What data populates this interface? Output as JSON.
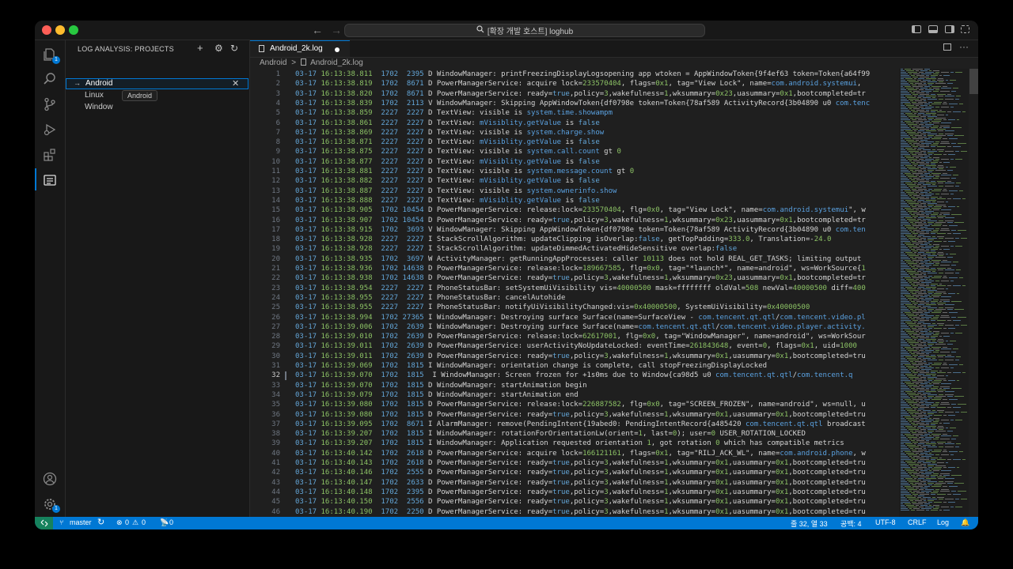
{
  "titlebar": {
    "search_text": "[확장 개발 호스트] loghub"
  },
  "activity": {
    "explorer_badge": "1",
    "accounts_label": "",
    "settings_badge": "1"
  },
  "sidebar": {
    "title": "LOG ANALYSIS: PROJECTS",
    "items": [
      {
        "label": "Android"
      },
      {
        "label": "Linux"
      },
      {
        "label": "Window"
      }
    ],
    "tooltip": "Android"
  },
  "editor": {
    "tab_label": "Android_2k.log",
    "breadcrumb": [
      "Android",
      ">",
      "Android_2k.log"
    ],
    "lines": [
      {
        "n": "1",
        "date": "03-17",
        "time": "16:13:38.811",
        "pid": "1702",
        "tid": "2395",
        "lvl": "D",
        "msg": "WindowManager: printFreezingDisplayLogsopening app wtoken = AppWindowToken{9f4ef63 token=Token{a64f99"
      },
      {
        "n": "2",
        "date": "03-17",
        "time": "16:13:38.819",
        "pid": "1702",
        "tid": "8671",
        "lvl": "D",
        "msg": "PowerManagerService: acquire lock=233570404, flags=0x1, tag=\"View Lock\", name=com.android.systemui,"
      },
      {
        "n": "3",
        "date": "03-17",
        "time": "16:13:38.820",
        "pid": "1702",
        "tid": "8671",
        "lvl": "D",
        "msg": "PowerManagerService: ready=true,policy=3,wakefulness=1,wksummary=0x23,uasummary=0x1,bootcompleted=tr"
      },
      {
        "n": "4",
        "date": "03-17",
        "time": "16:13:38.839",
        "pid": "1702",
        "tid": "2113",
        "lvl": "V",
        "msg": "WindowManager: Skipping AppWindowToken{df0798e token=Token{78af589 ActivityRecord{3b04890 u0 com.tenc"
      },
      {
        "n": "5",
        "date": "03-17",
        "time": "16:13:38.859",
        "pid": "2227",
        "tid": "2227",
        "lvl": "D",
        "msg": "TextView: visible is system.time.showampm"
      },
      {
        "n": "6",
        "date": "03-17",
        "time": "16:13:38.861",
        "pid": "2227",
        "tid": "2227",
        "lvl": "D",
        "msg": "TextView: mVisiblity.getValue is false"
      },
      {
        "n": "7",
        "date": "03-17",
        "time": "16:13:38.869",
        "pid": "2227",
        "tid": "2227",
        "lvl": "D",
        "msg": "TextView: visible is system.charge.show"
      },
      {
        "n": "8",
        "date": "03-17",
        "time": "16:13:38.871",
        "pid": "2227",
        "tid": "2227",
        "lvl": "D",
        "msg": "TextView: mVisiblity.getValue is false"
      },
      {
        "n": "9",
        "date": "03-17",
        "time": "16:13:38.875",
        "pid": "2227",
        "tid": "2227",
        "lvl": "D",
        "msg": "TextView: visible is system.call.count gt 0"
      },
      {
        "n": "10",
        "date": "03-17",
        "time": "16:13:38.877",
        "pid": "2227",
        "tid": "2227",
        "lvl": "D",
        "msg": "TextView: mVisiblity.getValue is false"
      },
      {
        "n": "11",
        "date": "03-17",
        "time": "16:13:38.881",
        "pid": "2227",
        "tid": "2227",
        "lvl": "D",
        "msg": "TextView: visible is system.message.count gt 0"
      },
      {
        "n": "12",
        "date": "03-17",
        "time": "16:13:38.882",
        "pid": "2227",
        "tid": "2227",
        "lvl": "D",
        "msg": "TextView: mVisiblity.getValue is false"
      },
      {
        "n": "13",
        "date": "03-17",
        "time": "16:13:38.887",
        "pid": "2227",
        "tid": "2227",
        "lvl": "D",
        "msg": "TextView: visible is system.ownerinfo.show"
      },
      {
        "n": "14",
        "date": "03-17",
        "time": "16:13:38.888",
        "pid": "2227",
        "tid": "2227",
        "lvl": "D",
        "msg": "TextView: mVisiblity.getValue is false"
      },
      {
        "n": "15",
        "date": "03-17",
        "time": "16:13:38.905",
        "pid": "1702",
        "tid": "10454",
        "lvl": "D",
        "msg": "PowerManagerService: release:lock=233570404, flg=0x0, tag=\"View Lock\", name=com.android.systemui\", w"
      },
      {
        "n": "16",
        "date": "03-17",
        "time": "16:13:38.907",
        "pid": "1702",
        "tid": "10454",
        "lvl": "D",
        "msg": "PowerManagerService: ready=true,policy=3,wakefulness=1,wksummary=0x23,uasummary=0x1,bootcompleted=tr"
      },
      {
        "n": "17",
        "date": "03-17",
        "time": "16:13:38.915",
        "pid": "1702",
        "tid": "3693",
        "lvl": "V",
        "msg": "WindowManager: Skipping AppWindowToken{df0798e token=Token{78af589 ActivityRecord{3b04890 u0 com.ten"
      },
      {
        "n": "18",
        "date": "03-17",
        "time": "16:13:38.928",
        "pid": "2227",
        "tid": "2227",
        "lvl": "I",
        "msg": "StackScrollAlgorithm: updateClipping isOverlap:false, getTopPadding=333.0, Translation=-24.0"
      },
      {
        "n": "19",
        "date": "03-17",
        "time": "16:13:38.928",
        "pid": "2227",
        "tid": "2227",
        "lvl": "I",
        "msg": "StackScrollAlgorithm: updateDimmedActivatedHideSensitive overlap:false"
      },
      {
        "n": "20",
        "date": "03-17",
        "time": "16:13:38.935",
        "pid": "1702",
        "tid": "3697",
        "lvl": "W",
        "msg": "ActivityManager: getRunningAppProcesses: caller 10113 does not hold REAL_GET_TASKS; limiting output"
      },
      {
        "n": "21",
        "date": "03-17",
        "time": "16:13:38.936",
        "pid": "1702",
        "tid": "14638",
        "lvl": "D",
        "msg": "PowerManagerService: release:lock=189667585, flg=0x0, tag=\"*launch*\", name=android\", ws=WorkSource{1"
      },
      {
        "n": "22",
        "date": "03-17",
        "time": "16:13:38.938",
        "pid": "1702",
        "tid": "14638",
        "lvl": "D",
        "msg": "PowerManagerService: ready=true,policy=3,wakefulness=1,wksummary=0x23,uasummary=0x1,bootcompleted=tr"
      },
      {
        "n": "23",
        "date": "03-17",
        "time": "16:13:38.954",
        "pid": "2227",
        "tid": "2227",
        "lvl": "I",
        "msg": "PhoneStatusBar: setSystemUiVisibility vis=40000500 mask=ffffffff oldVal=508 newVal=40000500 diff=400"
      },
      {
        "n": "24",
        "date": "03-17",
        "time": "16:13:38.955",
        "pid": "2227",
        "tid": "2227",
        "lvl": "I",
        "msg": "PhoneStatusBar: cancelAutohide"
      },
      {
        "n": "25",
        "date": "03-17",
        "time": "16:13:38.955",
        "pid": "2227",
        "tid": "2227",
        "lvl": "I",
        "msg": "PhoneStatusBar: notifyUiVisibilityChanged:vis=0x40000500, SystemUiVisibility=0x40000500"
      },
      {
        "n": "26",
        "date": "03-17",
        "time": "16:13:38.994",
        "pid": "1702",
        "tid": "27365",
        "lvl": "I",
        "msg": "WindowManager: Destroying surface Surface(name=SurfaceView - com.tencent.qt.qtl/com.tencent.video.pl"
      },
      {
        "n": "27",
        "date": "03-17",
        "time": "16:13:39.006",
        "pid": "1702",
        "tid": "2639",
        "lvl": "I",
        "msg": "WindowManager: Destroying surface Surface(name=com.tencent.qt.qtl/com.tencent.video.player.activity."
      },
      {
        "n": "28",
        "date": "03-17",
        "time": "16:13:39.010",
        "pid": "1702",
        "tid": "2639",
        "lvl": "D",
        "msg": "PowerManagerService: release:lock=62617001, flg=0x0, tag=\"WindowManager\", name=android\", ws=WorkSour"
      },
      {
        "n": "29",
        "date": "03-17",
        "time": "16:13:39.011",
        "pid": "1702",
        "tid": "2639",
        "lvl": "D",
        "msg": "PowerManagerService: userActivityNoUpdateLocked: eventTime=261843648, event=0, flags=0x1, uid=1000"
      },
      {
        "n": "30",
        "date": "03-17",
        "time": "16:13:39.011",
        "pid": "1702",
        "tid": "2639",
        "lvl": "D",
        "msg": "PowerManagerService: ready=true,policy=3,wakefulness=1,wksummary=0x1,uasummary=0x1,bootcompleted=tru"
      },
      {
        "n": "31",
        "date": "03-17",
        "time": "16:13:39.069",
        "pid": "1702",
        "tid": "1815",
        "lvl": "I",
        "msg": "WindowManager: orientation change is complete, call stopFreezingDisplayLocked"
      },
      {
        "n": "32",
        "date": "03-17",
        "time": "16:13:39.070",
        "pid": "1702",
        "tid": "1815",
        "lvl": " I",
        "msg": "WindowManager: Screen frozen for +1s0ms due to Window{ca98d5 u0 com.tencent.qt.qtl/com.tencent.q"
      },
      {
        "n": "33",
        "date": "03-17",
        "time": "16:13:39.070",
        "pid": "1702",
        "tid": "1815",
        "lvl": "D",
        "msg": "WindowManager: startAnimation begin"
      },
      {
        "n": "34",
        "date": "03-17",
        "time": "16:13:39.079",
        "pid": "1702",
        "tid": "1815",
        "lvl": "D",
        "msg": "WindowManager: startAnimation end"
      },
      {
        "n": "35",
        "date": "03-17",
        "time": "16:13:39.080",
        "pid": "1702",
        "tid": "1815",
        "lvl": "D",
        "msg": "PowerManagerService: release:lock=226887582, flg=0x0, tag=\"SCREEN_FROZEN\", name=android\", ws=null, u"
      },
      {
        "n": "36",
        "date": "03-17",
        "time": "16:13:39.080",
        "pid": "1702",
        "tid": "1815",
        "lvl": "D",
        "msg": "PowerManagerService: ready=true,policy=3,wakefulness=1,wksummary=0x1,uasummary=0x1,bootcompleted=tru"
      },
      {
        "n": "37",
        "date": "03-17",
        "time": "16:13:39.095",
        "pid": "1702",
        "tid": "8671",
        "lvl": "I",
        "msg": "AlarmManager: remove(PendingIntent{19abed0: PendingIntentRecord{a485420 com.tencent.qt.qtl broadcast"
      },
      {
        "n": "38",
        "date": "03-17",
        "time": "16:13:39.207",
        "pid": "1702",
        "tid": "1815",
        "lvl": "I",
        "msg": "WindowManager: rotationForOrientationLw(orient=1, last=0); user=0 USER_ROTATION_LOCKED"
      },
      {
        "n": "39",
        "date": "03-17",
        "time": "16:13:39.207",
        "pid": "1702",
        "tid": "1815",
        "lvl": "I",
        "msg": "WindowManager: Application requested orientation 1, got rotation 0 which has compatible metrics"
      },
      {
        "n": "40",
        "date": "03-17",
        "time": "16:13:40.142",
        "pid": "1702",
        "tid": "2618",
        "lvl": "D",
        "msg": "PowerManagerService: acquire lock=166121161, flags=0x1, tag=\"RILJ_ACK_WL\", name=com.android.phone, w"
      },
      {
        "n": "41",
        "date": "03-17",
        "time": "16:13:40.143",
        "pid": "1702",
        "tid": "2618",
        "lvl": "D",
        "msg": "PowerManagerService: ready=true,policy=3,wakefulness=1,wksummary=0x1,uasummary=0x1,bootcompleted=tru"
      },
      {
        "n": "42",
        "date": "03-17",
        "time": "16:13:40.146",
        "pid": "1702",
        "tid": "2555",
        "lvl": "D",
        "msg": "PowerManagerService: ready=true,policy=3,wakefulness=1,wksummary=0x1,uasummary=0x1,bootcompleted=tru"
      },
      {
        "n": "43",
        "date": "03-17",
        "time": "16:13:40.147",
        "pid": "1702",
        "tid": "2633",
        "lvl": "D",
        "msg": "PowerManagerService: ready=true,policy=3,wakefulness=1,wksummary=0x1,uasummary=0x1,bootcompleted=tru"
      },
      {
        "n": "44",
        "date": "03-17",
        "time": "16:13:40.148",
        "pid": "1702",
        "tid": "2395",
        "lvl": "D",
        "msg": "PowerManagerService: ready=true,policy=3,wakefulness=1,wksummary=0x1,uasummary=0x1,bootcompleted=tru"
      },
      {
        "n": "45",
        "date": "03-17",
        "time": "16:13:40.150",
        "pid": "1702",
        "tid": "2556",
        "lvl": "D",
        "msg": "PowerManagerService: ready=true,policy=3,wakefulness=1,wksummary=0x1,uasummary=0x1,bootcompleted=tru"
      },
      {
        "n": "46",
        "date": "03-17",
        "time": "16:13:40.190",
        "pid": "1702",
        "tid": "2250",
        "lvl": "D",
        "msg": "PowerManagerService: ready=true,policy=3,wakefulness=1,wksummary=0x1,uasummary=0x1,bootcompleted=tru"
      }
    ]
  },
  "statusbar": {
    "branch": "master",
    "errors": "0",
    "warnings": "0",
    "ports": "0",
    "position": "줄 32, 열 33",
    "spaces": "공백: 4",
    "encoding": "UTF-8",
    "eol": "CRLF",
    "language": "Log"
  },
  "colors": {
    "accent": "#0078d4",
    "date": "#63a6d8",
    "time": "#8cc265",
    "text": "#d4d4d4",
    "close": "#ff5f57",
    "minimize": "#febc2e",
    "maximize": "#28c840"
  }
}
